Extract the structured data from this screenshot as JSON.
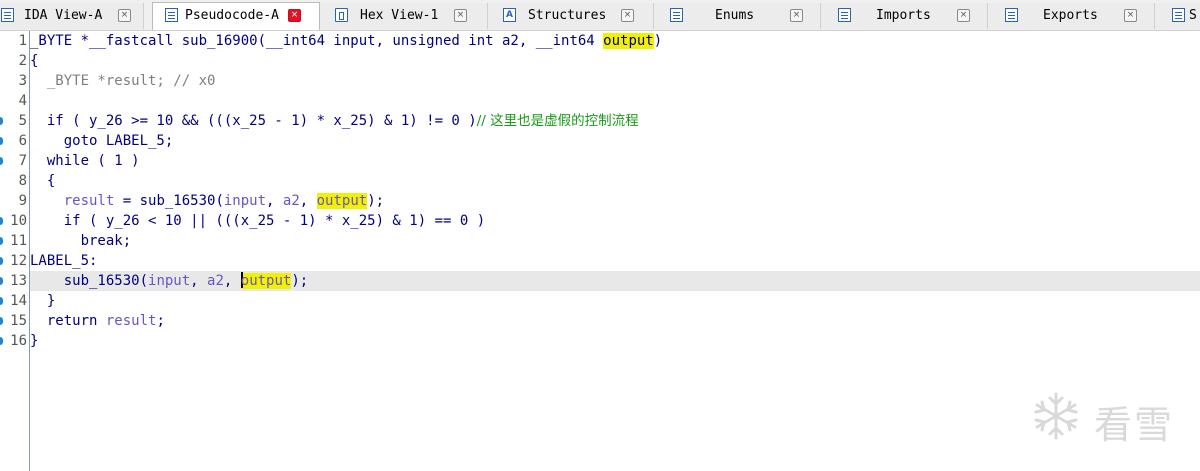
{
  "tabs": [
    {
      "label": "IDA View-A",
      "icon": "disassembly-icon",
      "active": false
    },
    {
      "label": "Pseudocode-A",
      "icon": "pseudocode-icon",
      "active": true
    },
    {
      "label": "Hex View-1",
      "icon": "hex-view-icon",
      "active": false
    },
    {
      "label": "Structures",
      "icon": "structures-icon",
      "active": false
    },
    {
      "label": "Enums",
      "icon": "enums-icon",
      "active": false
    },
    {
      "label": "Imports",
      "icon": "imports-icon",
      "active": false
    },
    {
      "label": "Exports",
      "icon": "exports-icon",
      "active": false
    },
    {
      "label": "S",
      "icon": "strings-icon",
      "active": false
    }
  ],
  "close_glyph": "×",
  "code": {
    "line_numbers": [
      "1",
      "2",
      "3",
      "4",
      "5",
      "6",
      "7",
      "8",
      "9",
      "10",
      "11",
      "12",
      "13",
      "14",
      "15",
      "16"
    ],
    "l1": {
      "a": "_BYTE *__fastcall sub_16900(__int64 input, unsigned int a2, __int64 ",
      "hl": "output",
      "b": ")"
    },
    "l2": "{",
    "l3": {
      "indent": "  ",
      "a": "_BYTE *result; ",
      "b": "// x0"
    },
    "l5": {
      "a": "  if ( y_26 >= 10 && (((x_25 - 1) * x_25) & 1) != 0 )",
      "cmt": "// 这里也是虚假的控制流程"
    },
    "l6": "    goto LABEL_5;",
    "l7": "  while ( 1 )",
    "l8": "  {",
    "l9": {
      "a": "    result",
      "b": " = sub_16530(",
      "c": "input",
      "d": ", ",
      "e": "a2",
      "f": ", ",
      "hl": "output",
      "g": ");"
    },
    "l10": "    if ( y_26 < 10 || (((x_25 - 1) * x_25) & 1) == 0 )",
    "l11": "      break;",
    "l12": "LABEL_5:",
    "l13": {
      "a": "    sub_16530(",
      "c": "input",
      "d": ", ",
      "e": "a2",
      "f": ", ",
      "hl1": "o",
      "hl2": "utput",
      "g": ");"
    },
    "l14": "  }",
    "l15": {
      "a": "  return ",
      "b": "result",
      "c": ";"
    },
    "l16": "}"
  },
  "watermark": {
    "text": "看雪",
    "icon": "snowflake-logo-icon"
  }
}
